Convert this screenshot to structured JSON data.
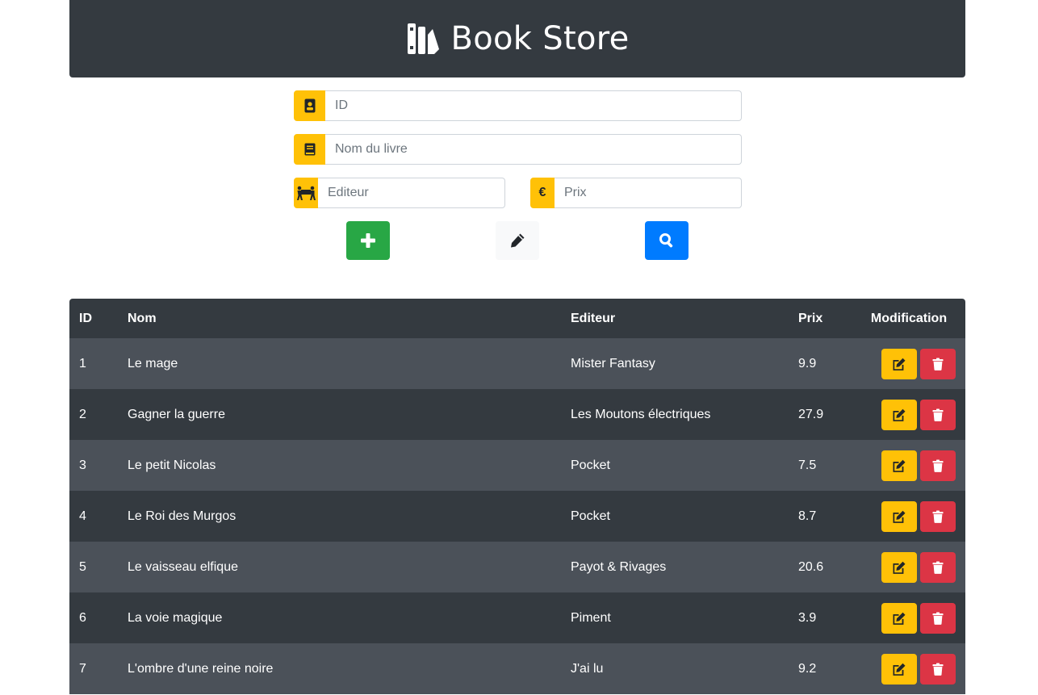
{
  "header": {
    "title": "Book Store",
    "logo_icon": "book-shelf-icon"
  },
  "form": {
    "id": {
      "placeholder": "ID",
      "value": "",
      "icon": "id-badge-icon"
    },
    "name": {
      "placeholder": "Nom du livre",
      "value": "",
      "icon": "book-icon"
    },
    "publisher": {
      "placeholder": "Editeur",
      "value": "",
      "icon": "people-carry-icon"
    },
    "price": {
      "placeholder": "Prix",
      "value": "",
      "icon": "euro-icon",
      "addon_text": "€"
    }
  },
  "buttons": {
    "add": {
      "icon": "plus-icon",
      "color": "#28a745"
    },
    "edit": {
      "icon": "pencil-icon",
      "color": "#f8f9fa"
    },
    "search": {
      "icon": "search-icon",
      "color": "#007bff"
    }
  },
  "table": {
    "headers": {
      "id": "ID",
      "nom": "Nom",
      "editeur": "Editeur",
      "prix": "Prix",
      "modification": "Modification"
    },
    "rows": [
      {
        "id": "1",
        "nom": "Le mage",
        "editeur": "Mister Fantasy",
        "prix": "9.9"
      },
      {
        "id": "2",
        "nom": "Gagner la guerre",
        "editeur": "Les Moutons électriques",
        "prix": "27.9"
      },
      {
        "id": "3",
        "nom": "Le petit Nicolas",
        "editeur": "Pocket",
        "prix": "7.5"
      },
      {
        "id": "4",
        "nom": "Le Roi des Murgos",
        "editeur": "Pocket",
        "prix": "8.7"
      },
      {
        "id": "5",
        "nom": "Le vaisseau elfique",
        "editeur": "Payot & Rivages",
        "prix": "20.6"
      },
      {
        "id": "6",
        "nom": "La voie magique",
        "editeur": "Piment",
        "prix": "3.9"
      },
      {
        "id": "7",
        "nom": "L'ombre d'une reine noire",
        "editeur": "J'ai lu",
        "prix": "9.2"
      }
    ],
    "row_actions": {
      "edit_icon": "edit-icon",
      "delete_icon": "trash-icon"
    }
  },
  "colors": {
    "header_bg": "#343a40",
    "accent_yellow": "#ffc107",
    "danger_red": "#dc3545",
    "row_light": "#4b5159",
    "row_dark": "#343a40"
  }
}
